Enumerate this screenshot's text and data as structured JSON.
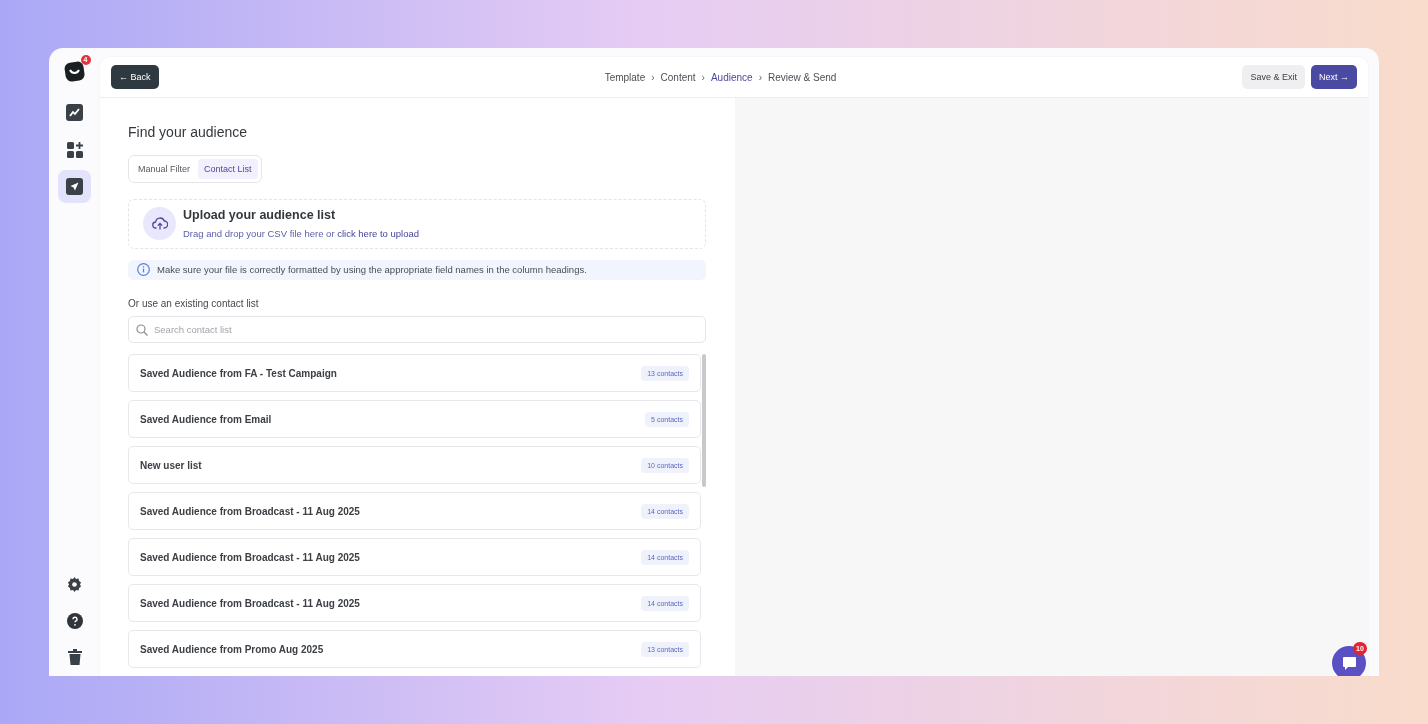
{
  "sidebar": {
    "logo_badge": "4",
    "items": [
      {
        "kind": "trend",
        "selected": false
      },
      {
        "kind": "apps",
        "selected": false
      },
      {
        "kind": "send",
        "selected": true
      }
    ],
    "bottom_items": [
      {
        "kind": "settings"
      },
      {
        "kind": "help"
      },
      {
        "kind": "trash"
      }
    ]
  },
  "top_bar": {
    "back_button": "← Back",
    "steps": [
      {
        "label": "Template",
        "selected": false
      },
      {
        "label": "Content",
        "selected": false
      },
      {
        "label": "Audience",
        "selected": true
      },
      {
        "label": "Review & Send",
        "selected": false
      }
    ],
    "separator": "›",
    "save_button": "Save & Exit",
    "next_button": "Next →"
  },
  "title": "Find your audience",
  "tabs": [
    {
      "label": "Manual Filter",
      "selected": false
    },
    {
      "label": "Contact List",
      "selected": true
    }
  ],
  "upload": {
    "title": "Upload your audience list",
    "text": "Drag and drop your CSV file here or ",
    "link": "click here to upload"
  },
  "info": "Make sure your file is correctly formatted by using the appropriate field names in the column headings.",
  "existing_label": "Or use an existing contact list",
  "search": {
    "placeholder": "Search contact list"
  },
  "lists": [
    {
      "name": "Saved Audience from FA - Test Campaign",
      "count": "13 contacts"
    },
    {
      "name": "Saved Audience from Email",
      "count": "5 contacts"
    },
    {
      "name": "New user list",
      "count": "10 contacts"
    },
    {
      "name": "Saved Audience from Broadcast - 11 Aug 2025",
      "count": "14 contacts"
    },
    {
      "name": "Saved Audience from Broadcast - 11 Aug 2025",
      "count": "14 contacts"
    },
    {
      "name": "Saved Audience from Broadcast - 11 Aug 2025",
      "count": "14 contacts"
    },
    {
      "name": "Saved Audience from Promo Aug 2025",
      "count": "13 contacts"
    }
  ],
  "chat": {
    "badge": "10"
  }
}
